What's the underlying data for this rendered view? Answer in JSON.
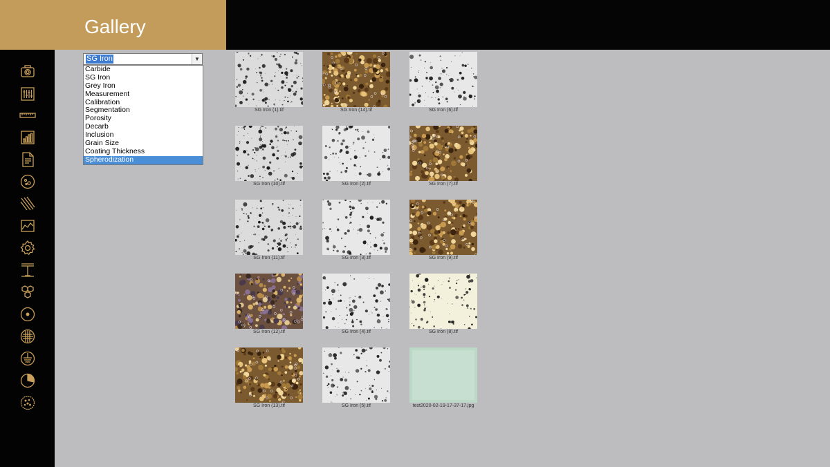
{
  "header": {
    "title": "Gallery"
  },
  "sidebar": {
    "icons": [
      {
        "name": "camera-icon"
      },
      {
        "name": "sliders-icon"
      },
      {
        "name": "ruler-icon"
      },
      {
        "name": "bar-chart-icon"
      },
      {
        "name": "document-icon"
      },
      {
        "name": "circle-dots-icon"
      },
      {
        "name": "diagonal-lines-icon"
      },
      {
        "name": "area-chart-icon"
      },
      {
        "name": "gear-icon"
      },
      {
        "name": "thickness-icon"
      },
      {
        "name": "hexagon-grid-icon"
      },
      {
        "name": "dot-circle-icon"
      },
      {
        "name": "grain-circle-icon"
      },
      {
        "name": "layered-circle-icon"
      },
      {
        "name": "pie-chart-icon"
      },
      {
        "name": "speckled-circle-icon"
      }
    ]
  },
  "category_select": {
    "selected": "SG Iron",
    "options": [
      "Carbide",
      "SG Iron",
      "Grey Iron",
      "Measurement",
      "Calibration",
      "Segmentation",
      "Porosity",
      "Decarb",
      "Inclusion",
      "Grain Size",
      "Coating Thickness",
      "Spherodization"
    ],
    "highlighted": "Spherodization"
  },
  "gallery": {
    "images": [
      {
        "caption": "SG Iron (1).tif",
        "style": "gray"
      },
      {
        "caption": "SG Iron (14).tif",
        "style": "brown"
      },
      {
        "caption": "SG Iron (6).tif",
        "style": "gray-light"
      },
      {
        "caption": "SG Iron (10).tif",
        "style": "gray"
      },
      {
        "caption": "SG Iron (2).tif",
        "style": "gray-light"
      },
      {
        "caption": "SG Iron (7).tif",
        "style": "brown"
      },
      {
        "caption": "SG Iron (11).tif",
        "style": "gray"
      },
      {
        "caption": "SG Iron (3).tif",
        "style": "gray-light"
      },
      {
        "caption": "SG Iron (9).tif",
        "style": "brown"
      },
      {
        "caption": "SG Iron (12).tif",
        "style": "brown-purple"
      },
      {
        "caption": "SG Iron (4).tif",
        "style": "gray-light"
      },
      {
        "caption": "SG Iron (8).tif",
        "style": "cream"
      },
      {
        "caption": "SG Iron (13).tif",
        "style": "brown"
      },
      {
        "caption": "SG Iron (5).tif",
        "style": "gray-light"
      },
      {
        "caption": "test2020-02-19-17-37-17.jpg",
        "style": "green"
      }
    ]
  },
  "colors": {
    "header_gold": "#c39c5b",
    "icon_gold": "#c9a05c",
    "main_bg": "#bdbdbf",
    "select_highlight": "#4a8ed8"
  }
}
